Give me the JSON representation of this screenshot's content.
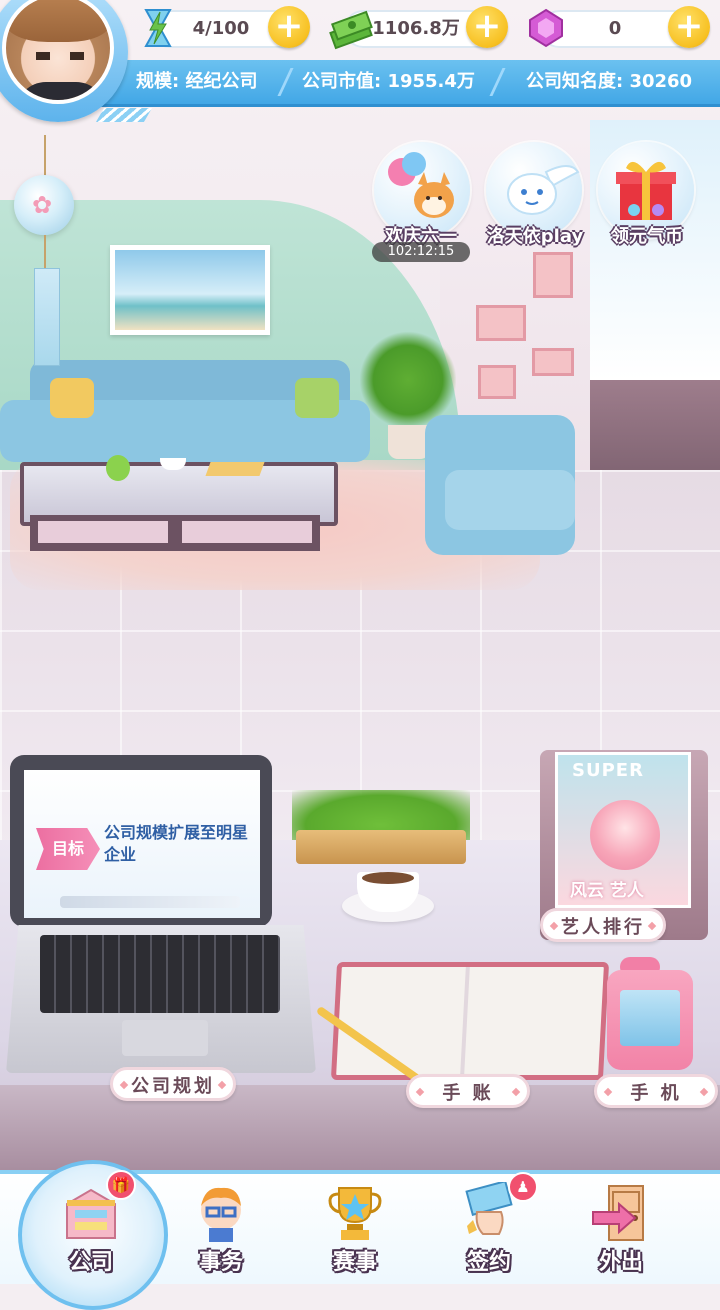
{
  "resources": {
    "energy": {
      "icon": "hourglass-bolt-icon",
      "value": "4/100"
    },
    "money": {
      "icon": "cash-stack-icon",
      "value": "1106.8万"
    },
    "gems": {
      "icon": "pink-gem-icon",
      "value": "0"
    },
    "plus_symbol": "+"
  },
  "company": {
    "scale_text": "规模: 经纪公司",
    "market_value_text": "公司市值: 1955.4万",
    "fame_text": "公司知名度: 30260"
  },
  "events": [
    {
      "label": "欢庆六一",
      "icon": "shiba-balloon-icon",
      "timer": "102:12:15"
    },
    {
      "label": "洛天依play",
      "icon": "winged-mascot-icon"
    },
    {
      "label": "领元气币",
      "icon": "gift-box-icon"
    }
  ],
  "laptop": {
    "goal_tag": "目标",
    "goal_text": "公司规模扩展至明星企业"
  },
  "magazine": {
    "cover_title": "SUPER",
    "cover_line": "风云 艺人"
  },
  "object_buttons": {
    "artist_ranking": "艺人排行",
    "company_plan": "公司规划",
    "journal": "手 账",
    "phone": "手 机"
  },
  "nav": [
    {
      "label": "公司",
      "icon": "company-building-icon",
      "active": true,
      "badge": "gift"
    },
    {
      "label": "事务",
      "icon": "staff-glasses-icon"
    },
    {
      "label": "赛事",
      "icon": "trophy-star-icon"
    },
    {
      "label": "签约",
      "icon": "contract-hand-icon",
      "badge": "person"
    },
    {
      "label": "外出",
      "icon": "door-exit-icon"
    }
  ],
  "colors": {
    "hud_blue": "#42a7e6",
    "plus_gold": "#f7c021",
    "nav_border": "#8ad0f4",
    "badge_red": "#f1506e"
  }
}
